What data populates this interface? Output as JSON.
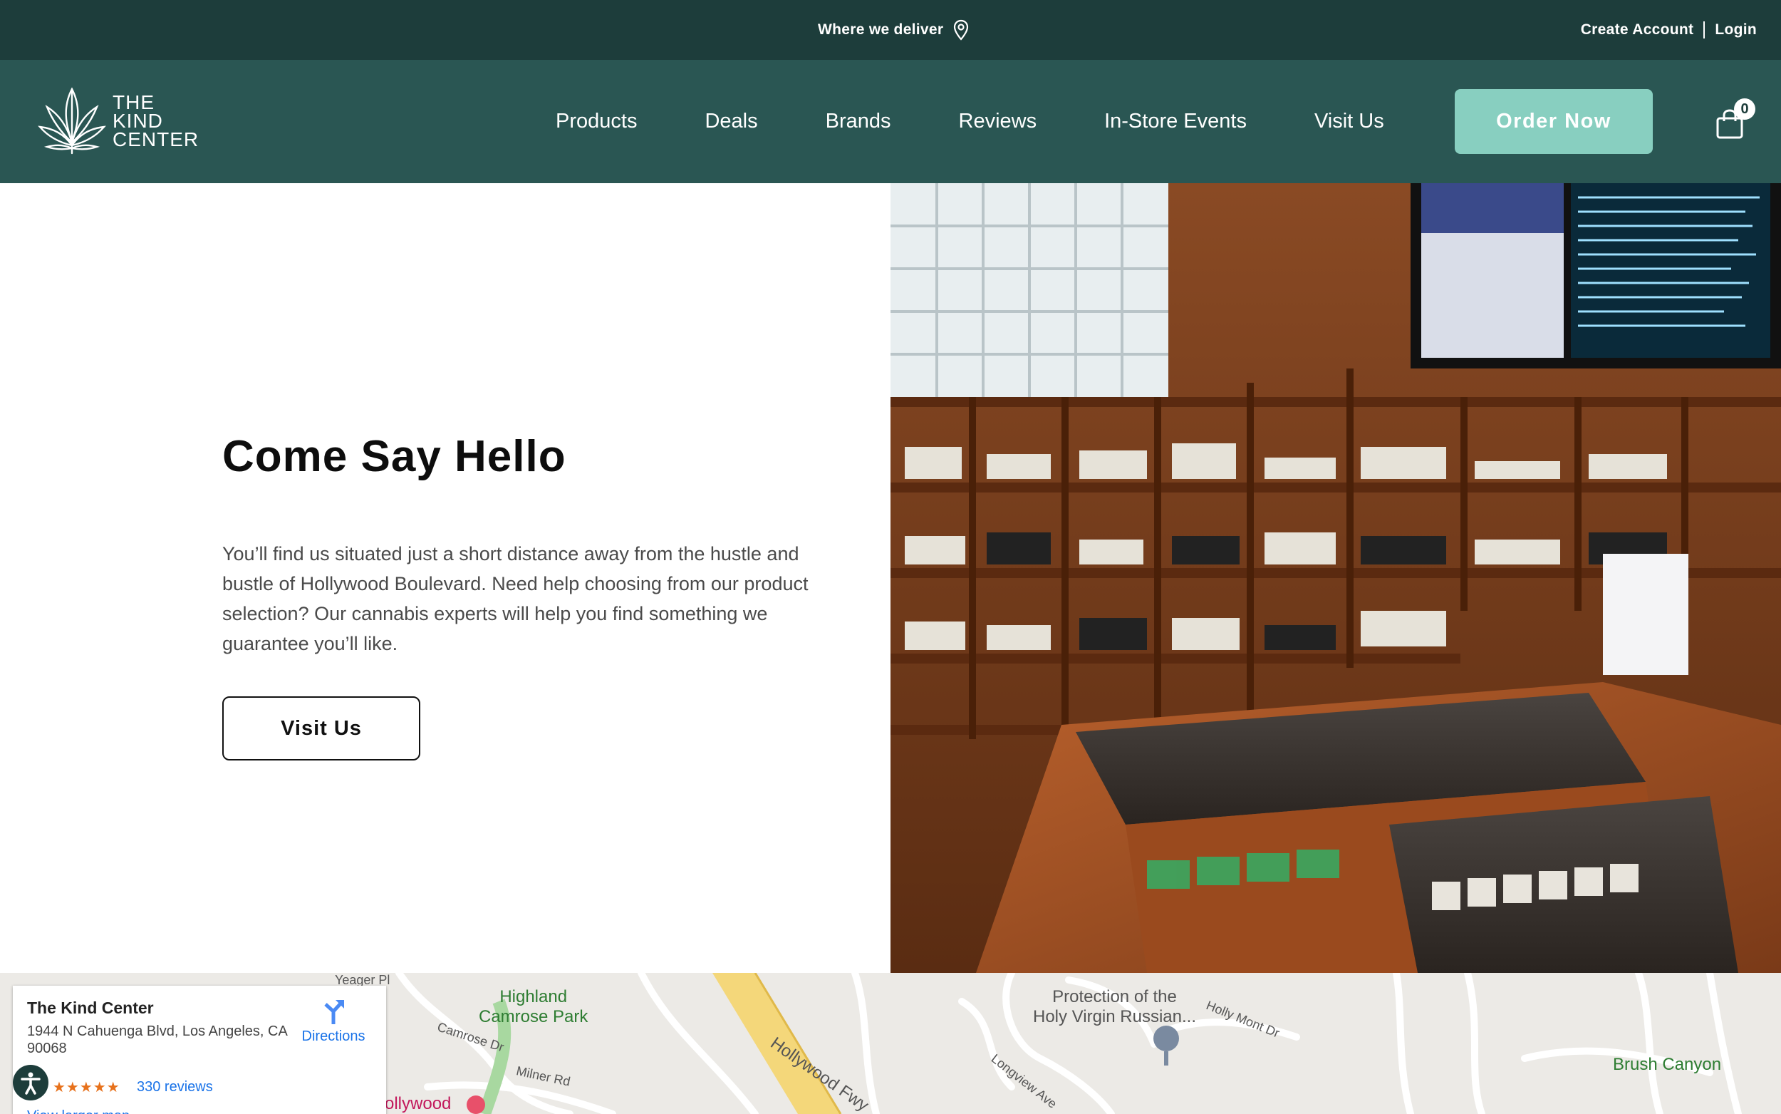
{
  "topbar": {
    "deliver_label": "Where we deliver",
    "create_account": "Create Account",
    "login": "Login"
  },
  "logo": {
    "line1": "THE",
    "line2": "KIND",
    "line3": "CENTER"
  },
  "nav": {
    "items": [
      "Products",
      "Deals",
      "Brands",
      "Reviews",
      "In-Store Events",
      "Visit Us"
    ],
    "order_button": "Order Now",
    "cart_count": "0"
  },
  "hero": {
    "title": "Come Say Hello",
    "body": "You’ll find us situated just a short distance away from the hustle and bustle of Hollywood Boulevard. Need help choosing from our product selection? Our cannabis experts will help you find something we guarantee you’ll like.",
    "button": "Visit Us"
  },
  "map": {
    "place_name": "The Kind Center",
    "address": "1944 N Cahuenga Blvd, Los Angeles, CA 90068",
    "rating_stars": "★★★★★",
    "reviews": "330 reviews",
    "directions": "Directions",
    "larger_map": "View larger map",
    "labels": {
      "park": "Highland\nCamrose Park",
      "church": "Protection of the\nHoly Virgin Russian...",
      "fwy": "Hollywood Fwy",
      "canyon": "Brush Canyon",
      "yeager": "Yeager Pl",
      "camrose": "Camrose Dr",
      "milner": "Milner Rd",
      "longview": "Longview Ave",
      "holly_mont": "Holly Mont Dr",
      "hollywood": "ollywood"
    }
  },
  "colors": {
    "topbar": "#1d3d3b",
    "navbar": "#2a5653",
    "accent": "#88cfc0"
  }
}
